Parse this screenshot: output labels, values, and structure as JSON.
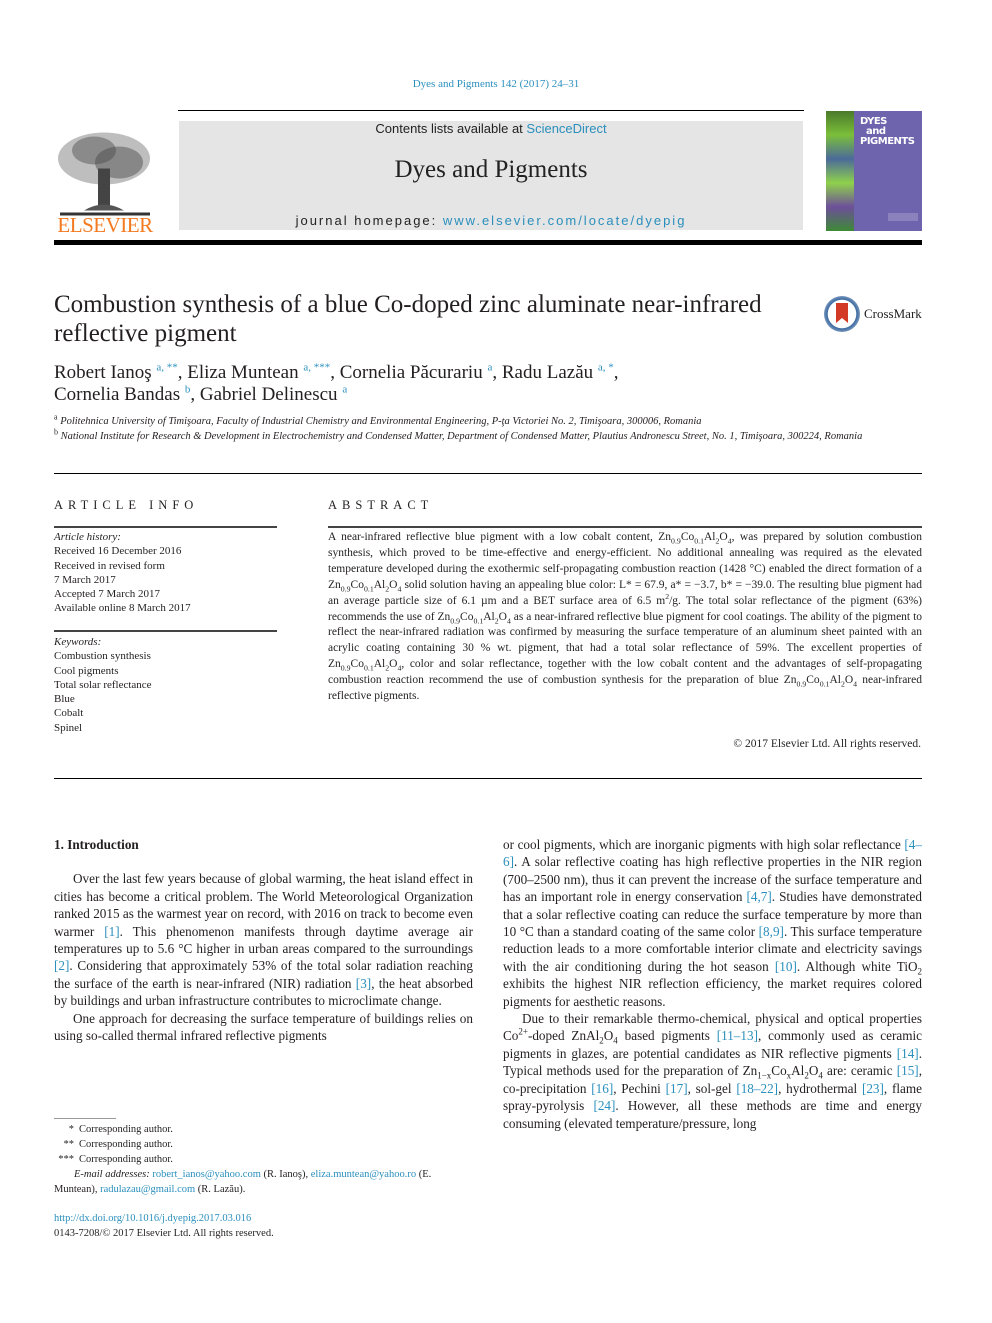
{
  "header": {
    "citation": "Dyes and Pigments 142 (2017) 24–31",
    "publisher_logo_text": "ELSEVIER",
    "contents_prefix": "Contents lists available at ",
    "contents_link": "ScienceDirect",
    "journal_name": "Dyes and Pigments",
    "homepage_prefix": "journal homepage: ",
    "homepage_url": "www.elsevier.com/locate/dyepig",
    "cover_title": "DYES\n  and\nPIGMENTS",
    "brand_color": "#f47a20",
    "link_color": "#2a8fbd"
  },
  "article": {
    "title": "Combustion synthesis of a blue Co-doped zinc aluminate near-infrared reflective pigment",
    "crossmark_label": "CrossMark",
    "authors": [
      {
        "name": "Robert Ianoş",
        "sup": "a, **"
      },
      {
        "name": "Eliza Muntean",
        "sup": "a, ***"
      },
      {
        "name": "Cornelia Păcurariu",
        "sup": "a"
      },
      {
        "name": "Radu Lazău",
        "sup": "a, *"
      },
      {
        "name": "Cornelia Bandas",
        "sup": "b"
      },
      {
        "name": "Gabriel Delinescu",
        "sup": "a"
      }
    ],
    "affiliations": [
      {
        "mark": "a",
        "text": "Politehnica University of Timişoara, Faculty of Industrial Chemistry and Environmental Engineering, P-ţa Victoriei No. 2, Timişoara, 300006, Romania"
      },
      {
        "mark": "b",
        "text": "National Institute for Research & Development in Electrochemistry and Condensed Matter, Department of Condensed Matter, Plautius Andronescu Street, No. 1, Timişoara, 300224, Romania"
      }
    ]
  },
  "article_info": {
    "heading": "ARTICLE INFO",
    "history_label": "Article history:",
    "history": [
      "Received 16 December 2016",
      "Received in revised form",
      "7 March 2017",
      "Accepted 7 March 2017",
      "Available online 8 March 2017"
    ],
    "keywords_label": "Keywords:",
    "keywords": [
      "Combustion synthesis",
      "Cool pigments",
      "Total solar reflectance",
      "Blue",
      "Cobalt",
      "Spinel"
    ]
  },
  "abstract": {
    "heading": "ABSTRACT",
    "text": "A near-infrared reflective blue pigment with a low cobalt content, Zn0.9Co0.1Al2O4, was prepared by solution combustion synthesis, which proved to be time-effective and energy-efficient. No additional annealing was required as the elevated temperature developed during the exothermic self-propagating combustion reaction (1428 °C) enabled the direct formation of a Zn0.9Co0.1Al2O4 solid solution having an appealing blue color: L* = 67.9, a* = −3.7, b* = −39.0. The resulting blue pigment had an average particle size of 6.1 µm and a BET surface area of 6.5 m2/g. The total solar reflectance of the pigment (63%) recommends the use of Zn0.9Co0.1Al2O4 as a near-infrared reflective blue pigment for cool coatings. The ability of the pigment to reflect the near-infrared radiation was confirmed by measuring the surface temperature of an aluminum sheet painted with an acrylic coating containing 30 % wt. pigment, that had a total solar reflectance of 59%. The excellent properties of Zn0.9Co0.1Al2O4, color and solar reflectance, together with the low cobalt content and the advantages of self-propagating combustion reaction recommend the use of combustion synthesis for the preparation of blue Zn0.9Co0.1Al2O4 near-infrared reflective pigments.",
    "copyright": "© 2017 Elsevier Ltd. All rights reserved."
  },
  "body": {
    "section_heading": "1.  Introduction",
    "paragraphs": [
      {
        "segments": [
          {
            "t": "Over the last few years because of global warming, the heat island effect in cities has become a critical problem. The World Meteorological Organization ranked 2015 as the warmest year on record, with 2016 on track to become even warmer "
          },
          {
            "ref": "[1]"
          },
          {
            "t": ". This phenomenon manifests through daytime average air temperatures up to 5.6 °C higher in urban areas compared to the surroundings "
          },
          {
            "ref": "[2]"
          },
          {
            "t": ". Considering that approximately 53% of the total solar radiation reaching the surface of the earth is near-infrared (NIR) radiation "
          },
          {
            "ref": "[3]"
          },
          {
            "t": ", the heat absorbed by buildings and urban infrastructure contributes to microclimate change."
          }
        ]
      },
      {
        "segments": [
          {
            "t": "One approach for decreasing the surface temperature of buildings relies on using so-called thermal infrared reflective pigments or cool pigments, which are inorganic pigments with high solar reflectance "
          },
          {
            "ref": "[4–6]"
          },
          {
            "t": ". A solar reflective coating has high reflective properties in the NIR region (700–2500 nm), thus it can prevent the increase of the surface temperature and has an important role in energy conservation "
          },
          {
            "ref": "[4,7]"
          },
          {
            "t": ". Studies have demonstrated that a solar reflective coating can reduce the surface temperature by more than 10 °C than a standard coating of the same color "
          },
          {
            "ref": "[8,9]"
          },
          {
            "t": ". This surface temperature reduction leads to a more comfortable interior climate and electricity savings with the air conditioning during the hot season "
          },
          {
            "ref": "[10]"
          },
          {
            "t": ". Although white TiO2 exhibits the highest NIR reflection efficiency, the market requires colored pigments for aesthetic reasons."
          }
        ]
      },
      {
        "segments": [
          {
            "t": "Due to their remarkable thermo-chemical, physical and optical properties Co2+-doped ZnAl2O4 based pigments "
          },
          {
            "ref": "[11–13]"
          },
          {
            "t": ", commonly used as ceramic pigments in glazes, are potential candidates as NIR reflective pigments "
          },
          {
            "ref": "[14]"
          },
          {
            "t": ". Typical methods used for the preparation of Zn1−xCoxAl2O4 are: ceramic "
          },
          {
            "ref": "[15]"
          },
          {
            "t": ", co-precipitation "
          },
          {
            "ref": "[16]"
          },
          {
            "t": ", Pechini "
          },
          {
            "ref": "[17]"
          },
          {
            "t": ", sol-gel "
          },
          {
            "ref": "[18–22]"
          },
          {
            "t": ", hydrothermal "
          },
          {
            "ref": "[23]"
          },
          {
            "t": ", flame spray-pyrolysis "
          },
          {
            "ref": "[24]"
          },
          {
            "t": ". However, all these methods are time and energy consuming (elevated temperature/pressure, long"
          }
        ]
      }
    ]
  },
  "footnotes": {
    "corresponding": [
      {
        "mark": "*",
        "text": "Corresponding author."
      },
      {
        "mark": "**",
        "text": "Corresponding author."
      },
      {
        "mark": "***",
        "text": "Corresponding author."
      }
    ],
    "email_label": "E-mail addresses:",
    "emails": [
      {
        "email": "robert_ianos@yahoo.com",
        "who": "(R. Ianoş)"
      },
      {
        "email": "eliza.muntean@yahoo.ro",
        "who": "(E. Muntean)"
      },
      {
        "email": "radulazau@gmail.com",
        "who": "(R. Lazău)."
      }
    ],
    "doi": "http://dx.doi.org/10.1016/j.dyepig.2017.03.016",
    "issn_line": "0143-7208/© 2017 Elsevier Ltd. All rights reserved."
  }
}
